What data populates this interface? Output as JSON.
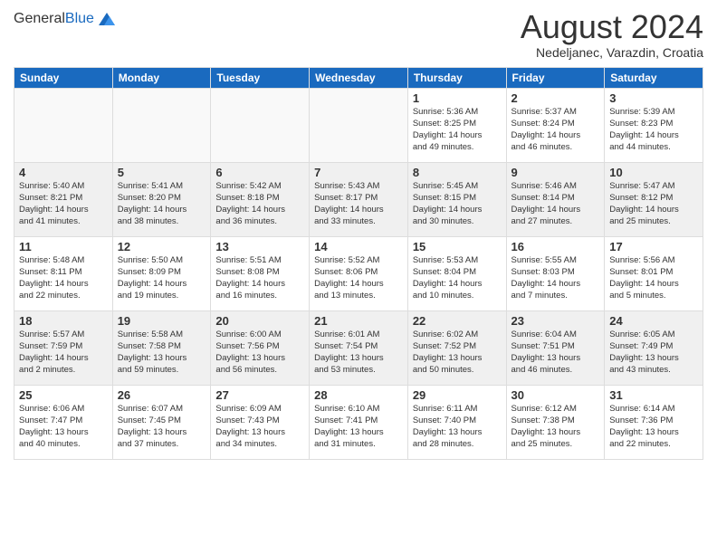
{
  "header": {
    "logo_general": "General",
    "logo_blue": "Blue",
    "month_year": "August 2024",
    "location": "Nedeljanec, Varazdin, Croatia"
  },
  "days_of_week": [
    "Sunday",
    "Monday",
    "Tuesday",
    "Wednesday",
    "Thursday",
    "Friday",
    "Saturday"
  ],
  "weeks": [
    [
      {
        "day": "",
        "info": ""
      },
      {
        "day": "",
        "info": ""
      },
      {
        "day": "",
        "info": ""
      },
      {
        "day": "",
        "info": ""
      },
      {
        "day": "1",
        "info": "Sunrise: 5:36 AM\nSunset: 8:25 PM\nDaylight: 14 hours\nand 49 minutes."
      },
      {
        "day": "2",
        "info": "Sunrise: 5:37 AM\nSunset: 8:24 PM\nDaylight: 14 hours\nand 46 minutes."
      },
      {
        "day": "3",
        "info": "Sunrise: 5:39 AM\nSunset: 8:23 PM\nDaylight: 14 hours\nand 44 minutes."
      }
    ],
    [
      {
        "day": "4",
        "info": "Sunrise: 5:40 AM\nSunset: 8:21 PM\nDaylight: 14 hours\nand 41 minutes."
      },
      {
        "day": "5",
        "info": "Sunrise: 5:41 AM\nSunset: 8:20 PM\nDaylight: 14 hours\nand 38 minutes."
      },
      {
        "day": "6",
        "info": "Sunrise: 5:42 AM\nSunset: 8:18 PM\nDaylight: 14 hours\nand 36 minutes."
      },
      {
        "day": "7",
        "info": "Sunrise: 5:43 AM\nSunset: 8:17 PM\nDaylight: 14 hours\nand 33 minutes."
      },
      {
        "day": "8",
        "info": "Sunrise: 5:45 AM\nSunset: 8:15 PM\nDaylight: 14 hours\nand 30 minutes."
      },
      {
        "day": "9",
        "info": "Sunrise: 5:46 AM\nSunset: 8:14 PM\nDaylight: 14 hours\nand 27 minutes."
      },
      {
        "day": "10",
        "info": "Sunrise: 5:47 AM\nSunset: 8:12 PM\nDaylight: 14 hours\nand 25 minutes."
      }
    ],
    [
      {
        "day": "11",
        "info": "Sunrise: 5:48 AM\nSunset: 8:11 PM\nDaylight: 14 hours\nand 22 minutes."
      },
      {
        "day": "12",
        "info": "Sunrise: 5:50 AM\nSunset: 8:09 PM\nDaylight: 14 hours\nand 19 minutes."
      },
      {
        "day": "13",
        "info": "Sunrise: 5:51 AM\nSunset: 8:08 PM\nDaylight: 14 hours\nand 16 minutes."
      },
      {
        "day": "14",
        "info": "Sunrise: 5:52 AM\nSunset: 8:06 PM\nDaylight: 14 hours\nand 13 minutes."
      },
      {
        "day": "15",
        "info": "Sunrise: 5:53 AM\nSunset: 8:04 PM\nDaylight: 14 hours\nand 10 minutes."
      },
      {
        "day": "16",
        "info": "Sunrise: 5:55 AM\nSunset: 8:03 PM\nDaylight: 14 hours\nand 7 minutes."
      },
      {
        "day": "17",
        "info": "Sunrise: 5:56 AM\nSunset: 8:01 PM\nDaylight: 14 hours\nand 5 minutes."
      }
    ],
    [
      {
        "day": "18",
        "info": "Sunrise: 5:57 AM\nSunset: 7:59 PM\nDaylight: 14 hours\nand 2 minutes."
      },
      {
        "day": "19",
        "info": "Sunrise: 5:58 AM\nSunset: 7:58 PM\nDaylight: 13 hours\nand 59 minutes."
      },
      {
        "day": "20",
        "info": "Sunrise: 6:00 AM\nSunset: 7:56 PM\nDaylight: 13 hours\nand 56 minutes."
      },
      {
        "day": "21",
        "info": "Sunrise: 6:01 AM\nSunset: 7:54 PM\nDaylight: 13 hours\nand 53 minutes."
      },
      {
        "day": "22",
        "info": "Sunrise: 6:02 AM\nSunset: 7:52 PM\nDaylight: 13 hours\nand 50 minutes."
      },
      {
        "day": "23",
        "info": "Sunrise: 6:04 AM\nSunset: 7:51 PM\nDaylight: 13 hours\nand 46 minutes."
      },
      {
        "day": "24",
        "info": "Sunrise: 6:05 AM\nSunset: 7:49 PM\nDaylight: 13 hours\nand 43 minutes."
      }
    ],
    [
      {
        "day": "25",
        "info": "Sunrise: 6:06 AM\nSunset: 7:47 PM\nDaylight: 13 hours\nand 40 minutes."
      },
      {
        "day": "26",
        "info": "Sunrise: 6:07 AM\nSunset: 7:45 PM\nDaylight: 13 hours\nand 37 minutes."
      },
      {
        "day": "27",
        "info": "Sunrise: 6:09 AM\nSunset: 7:43 PM\nDaylight: 13 hours\nand 34 minutes."
      },
      {
        "day": "28",
        "info": "Sunrise: 6:10 AM\nSunset: 7:41 PM\nDaylight: 13 hours\nand 31 minutes."
      },
      {
        "day": "29",
        "info": "Sunrise: 6:11 AM\nSunset: 7:40 PM\nDaylight: 13 hours\nand 28 minutes."
      },
      {
        "day": "30",
        "info": "Sunrise: 6:12 AM\nSunset: 7:38 PM\nDaylight: 13 hours\nand 25 minutes."
      },
      {
        "day": "31",
        "info": "Sunrise: 6:14 AM\nSunset: 7:36 PM\nDaylight: 13 hours\nand 22 minutes."
      }
    ]
  ]
}
